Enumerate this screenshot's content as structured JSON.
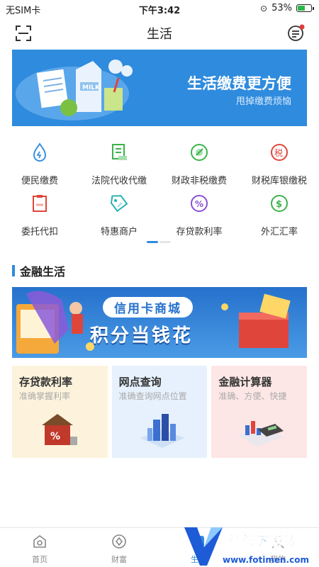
{
  "status": {
    "carrier": "无SIM卡",
    "time": "下午3:42",
    "battery": "53%"
  },
  "nav": {
    "title": "生活"
  },
  "banner": {
    "title": "生活缴费更方便",
    "subtitle": "甩掉缴费烦恼",
    "carton_label": "MILK"
  },
  "services": [
    {
      "label": "便民缴费",
      "icon": "water-drop-icon",
      "color": "#3b8fe0"
    },
    {
      "label": "法院代收代缴",
      "icon": "document-icon",
      "color": "#3bb34a"
    },
    {
      "label": "财政非税缴费",
      "icon": "coin-icon",
      "color": "#3bb34a"
    },
    {
      "label": "财税库银缴税",
      "icon": "tax-icon",
      "color": "#e0453b"
    },
    {
      "label": "委托代扣",
      "icon": "clipboard-icon",
      "color": "#e0453b"
    },
    {
      "label": "特惠商户",
      "icon": "tag-icon",
      "color": "#27b3b3"
    },
    {
      "label": "存贷款利率",
      "icon": "percent-icon",
      "color": "#8a4fd6"
    },
    {
      "label": "外汇汇率",
      "icon": "dollar-icon",
      "color": "#3bb34a"
    }
  ],
  "section": {
    "title": "金融生活"
  },
  "promo": {
    "ribbon": "信用卡商城",
    "headline": "积分当钱花"
  },
  "cards": [
    {
      "title": "存贷款利率",
      "subtitle": "准确掌握利率",
      "bg": "#fdf3dc"
    },
    {
      "title": "网点查询",
      "subtitle": "准确查询网点位置",
      "bg": "#e6f1fd"
    },
    {
      "title": "金融计算器",
      "subtitle": "准确、方便、快捷",
      "bg": "#fde6e6"
    }
  ],
  "tabs": [
    {
      "label": "首页",
      "icon": "home-icon"
    },
    {
      "label": "财富",
      "icon": "wealth-icon"
    },
    {
      "label": "生活",
      "icon": "life-icon"
    },
    {
      "label": "我的",
      "icon": "profile-icon"
    }
  ],
  "watermark": {
    "name": "清源下载站",
    "url": "www.fotimen.com"
  }
}
